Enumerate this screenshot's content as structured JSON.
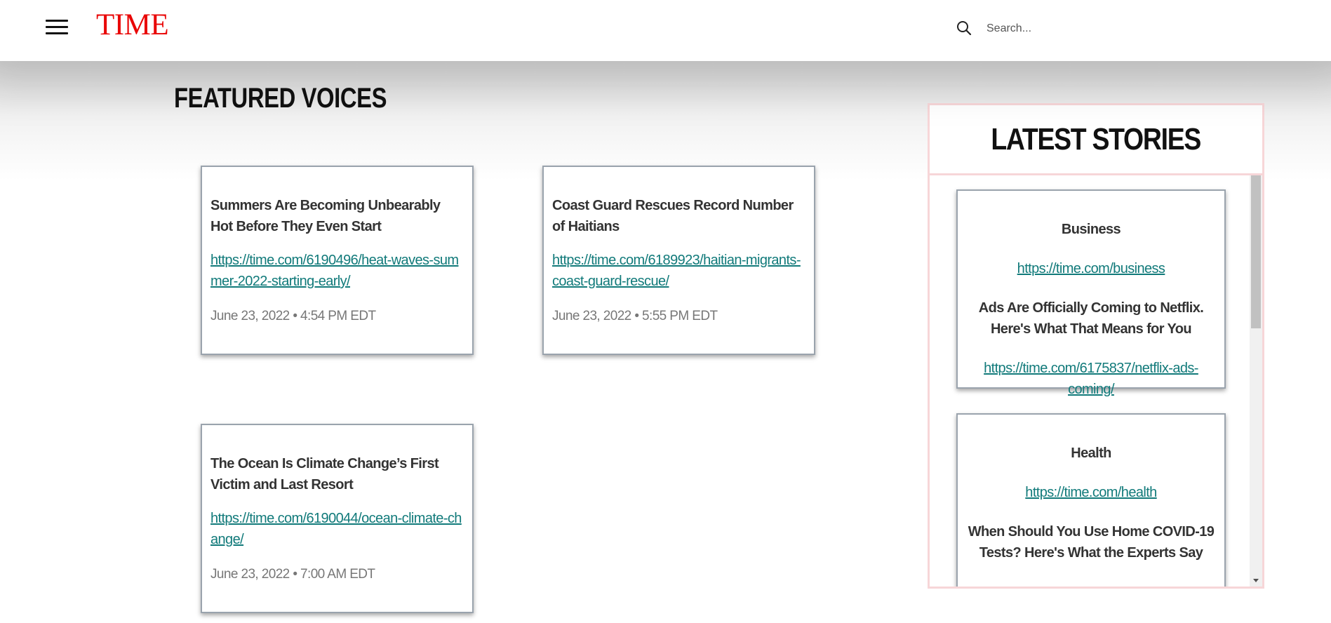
{
  "header": {
    "logo": "TIME",
    "search_placeholder": "Search..."
  },
  "featured": {
    "title": "FEATURED VOICES",
    "cards": [
      {
        "title": "Summers Are Becoming Unbearably Hot Before They Even Start",
        "url": "https://time.com/6190496/heat-waves-summer-2022-starting-early/",
        "date": "June 23, 2022 • 4:54 PM EDT"
      },
      {
        "title": "Coast Guard Rescues Record Number of Haitians",
        "url": "https://time.com/6189923/haitian-migrants-coast-guard-rescue/",
        "date": "June 23, 2022 • 5:55 PM EDT"
      },
      {
        "title": "The Ocean Is Climate Change’s First Victim and Last Resort",
        "url": "https://time.com/6190044/ocean-climate-change/",
        "date": "June 23, 2022 • 7:00 AM EDT"
      }
    ]
  },
  "latest": {
    "title": "LATEST STORIES",
    "stories": [
      {
        "category": "Business",
        "category_url": "https://time.com/business",
        "headline": "Ads Are Officially Coming to Netflix. Here's What That Means for You",
        "url": "https://time.com/6175837/netflix-ads-coming/"
      },
      {
        "category": "Health",
        "category_url": "https://time.com/health",
        "headline": "When Should You Use Home COVID-19 Tests? Here's What the Experts Say"
      }
    ]
  },
  "colors": {
    "logo": "#e90606",
    "link": "#117a7a",
    "latest_border": "#f7d6d8"
  }
}
